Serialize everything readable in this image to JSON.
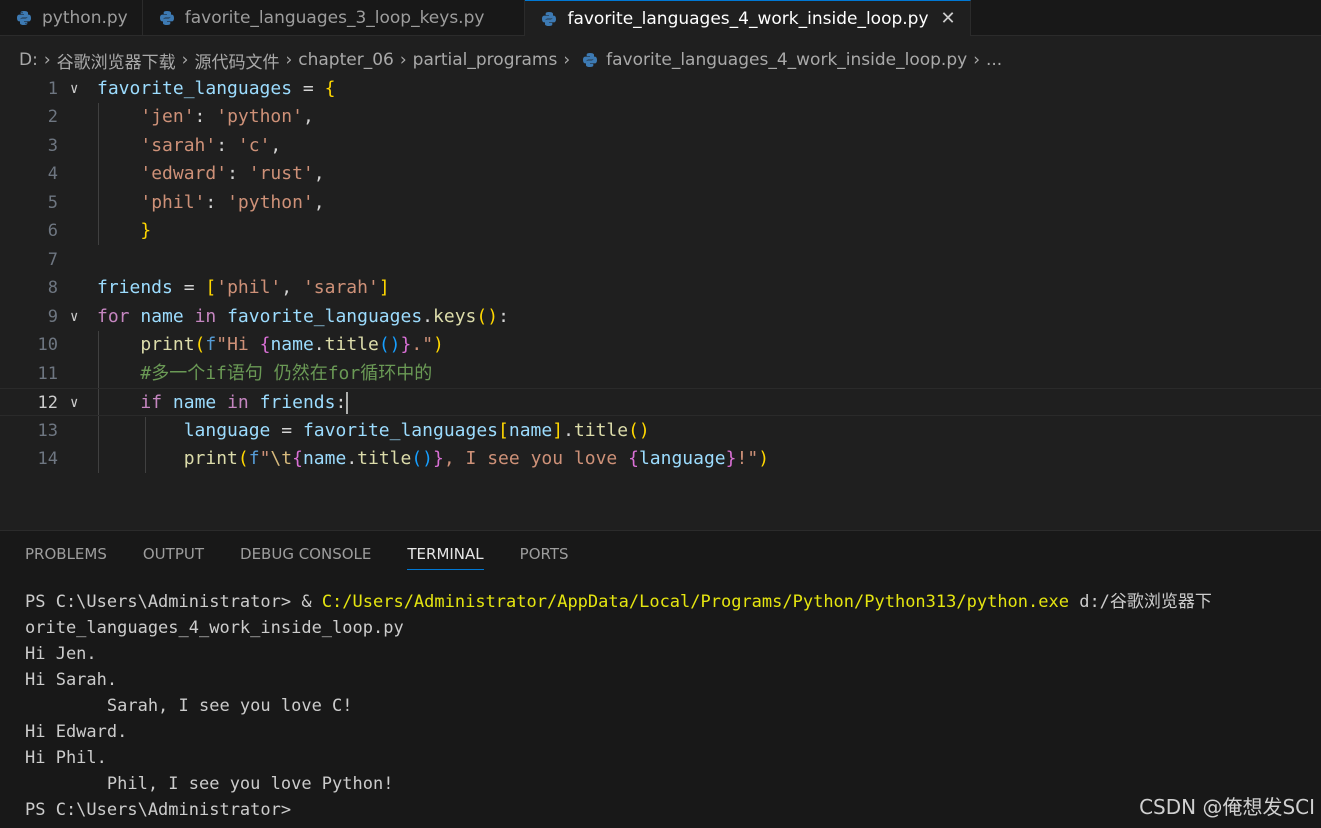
{
  "tabs": [
    {
      "label": "python.py",
      "active": false
    },
    {
      "label": "favorite_languages_3_loop_keys.py",
      "active": false
    },
    {
      "label": "favorite_languages_4_work_inside_loop.py",
      "active": true
    }
  ],
  "breadcrumb": {
    "parts": [
      "D:",
      "谷歌浏览器下载",
      "源代码文件",
      "chapter_06",
      "partial_programs"
    ],
    "file": "favorite_languages_4_work_inside_loop.py",
    "more": "..."
  },
  "editor": {
    "line_numbers": [
      "1",
      "2",
      "3",
      "4",
      "5",
      "6",
      "7",
      "8",
      "9",
      "10",
      "11",
      "12",
      "13",
      "14"
    ],
    "current_line": "12"
  },
  "panel": {
    "tabs": [
      {
        "label": "PROBLEMS",
        "active": false
      },
      {
        "label": "OUTPUT",
        "active": false
      },
      {
        "label": "DEBUG CONSOLE",
        "active": false
      },
      {
        "label": "TERMINAL",
        "active": true
      },
      {
        "label": "PORTS",
        "active": false
      }
    ],
    "terminal": {
      "prompt1": "PS C:\\Users\\Administrator> & ",
      "cmd_path": "C:/Users/Administrator/AppData/Local/Programs/Python/Python313/python.exe",
      "cmd_arg": " d:/谷歌浏览器下",
      "line2": "orite_languages_4_work_inside_loop.py",
      "line3": "Hi Jen.",
      "line4": "Hi Sarah.",
      "line5": "        Sarah, I see you love C!",
      "line6": "Hi Edward.",
      "line7": "Hi Phil.",
      "line8": "        Phil, I see you love Python!",
      "line9": "PS C:\\Users\\Administrator>"
    }
  },
  "watermark": "CSDN @俺想发SCI",
  "colors": {
    "accent": "#0078d4",
    "editor_bg": "#1f1f1f",
    "panel_bg": "#181818"
  },
  "icons": [
    "python-file-icon",
    "close-icon",
    "chevron-right-icon",
    "fold-chevron-icon"
  ]
}
